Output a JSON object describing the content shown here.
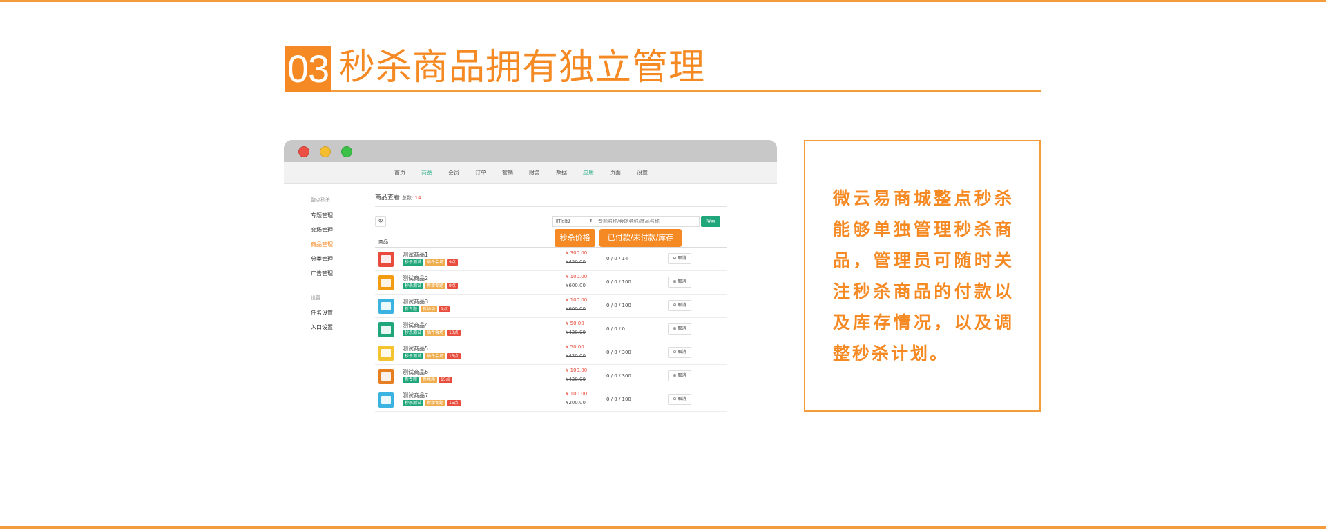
{
  "heading": {
    "number": "03",
    "title": "秒杀商品拥有独立管理"
  },
  "colors": {
    "accent": "#f58a24",
    "green": "#1fa67a",
    "red": "#e74c3c"
  },
  "browser": {
    "nav": [
      "首页",
      "商品",
      "会员",
      "订单",
      "营销",
      "财务",
      "数据",
      "应用",
      "页面",
      "设置"
    ],
    "nav_active": [
      "商品",
      "应用"
    ],
    "sidebar": {
      "group1": "整点秒杀",
      "items1": [
        "专题管理",
        "会场管理",
        "商品管理",
        "分类管理",
        "广告管理"
      ],
      "active": "商品管理",
      "group2": "设置",
      "items2": [
        "任务设置",
        "入口设置"
      ]
    },
    "content": {
      "title": "商品查看",
      "count_label": "总数:",
      "count": "14",
      "refresh_icon": "refresh-icon",
      "time_select": "时间段",
      "search_placeholder": "专题名称/会场名称/商品名称",
      "search_button": "搜索",
      "column_product": "商品",
      "cancel_label": "取消",
      "rows": [
        {
          "name": "测试商品1",
          "tags": [
            "秒杀测试",
            "插件会场",
            "9点"
          ],
          "price": "¥ 300.00",
          "original": "¥450.00",
          "stock": "0 / 0 / 14",
          "icon": "mail-icon",
          "icon_color": "#e74c3c"
        },
        {
          "name": "测试商品2",
          "tags": [
            "秒杀测试",
            "新增专题",
            "9点"
          ],
          "price": "¥ 100.00",
          "original": "¥600.00",
          "stock": "0 / 0 / 100",
          "icon": "location-icon",
          "icon_color": "#f39c12"
        },
        {
          "name": "测试商品3",
          "tags": [
            "新专题",
            "新场场",
            "9点"
          ],
          "price": "¥ 100.00",
          "original": "¥600.00",
          "stock": "0 / 0 / 100",
          "icon": "calendar-icon",
          "icon_color": "#3bb3e0"
        },
        {
          "name": "测试商品4",
          "tags": [
            "秒杀测试",
            "插件会场",
            "10点"
          ],
          "price": "¥ 50.00",
          "original": "¥420.00",
          "stock": "0 / 0 / 0",
          "icon": "billboard-icon",
          "icon_color": "#1fa67a"
        },
        {
          "name": "测试商品5",
          "tags": [
            "秒杀测试",
            "插件会场",
            "15点"
          ],
          "price": "¥ 50.00",
          "original": "¥420.00",
          "stock": "0 / 0 / 300",
          "icon": "chart-icon",
          "icon_color": "#f4c430"
        },
        {
          "name": "测试商品6",
          "tags": [
            "新专题",
            "新场场",
            "15点"
          ],
          "price": "¥ 100.00",
          "original": "¥420.00",
          "stock": "0 / 0 / 300",
          "icon": "layers-icon",
          "icon_color": "#e67e22"
        },
        {
          "name": "测试商品7",
          "tags": [
            "秒杀测试",
            "新增专题",
            "15点"
          ],
          "price": "¥ 100.00",
          "original": "¥200.00",
          "stock": "0 / 0 / 100",
          "icon": "award-icon",
          "icon_color": "#3bb3e0"
        }
      ]
    },
    "callouts": [
      "秒杀价格",
      "已付款/未付款/库存"
    ]
  },
  "description": "微云易商城整点秒杀能够单独管理秒杀商品，管理员可随时关注秒杀商品的付款以及库存情况，以及调整秒杀计划。"
}
